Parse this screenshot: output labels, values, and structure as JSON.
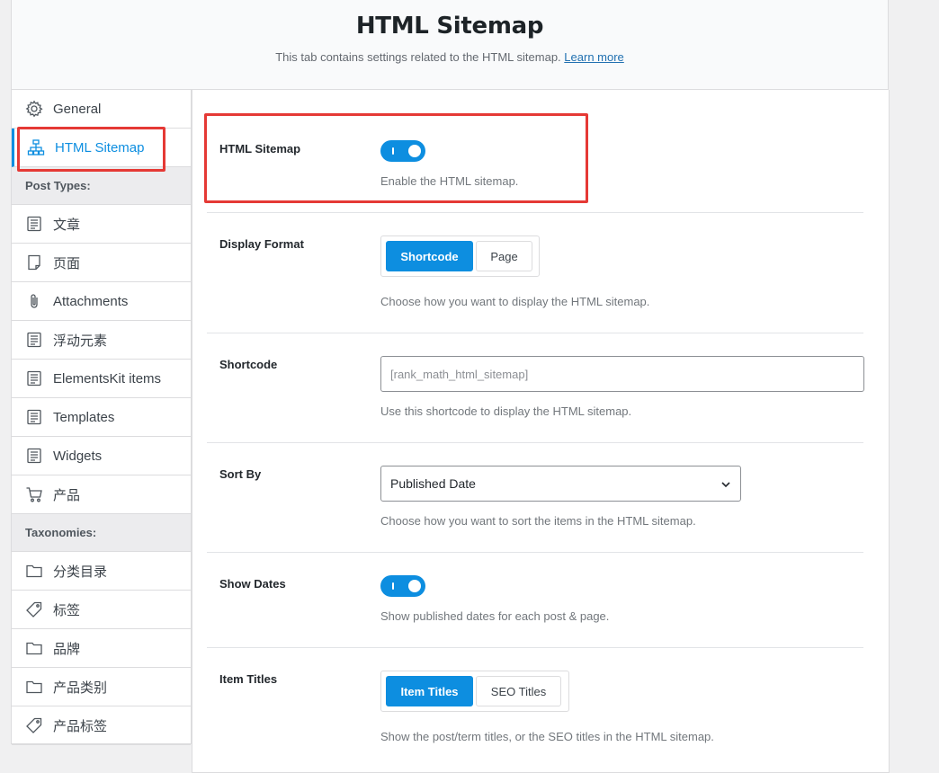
{
  "header": {
    "title": "HTML Sitemap",
    "description": "This tab contains settings related to the HTML sitemap.",
    "learn_more": "Learn more"
  },
  "sidebar": {
    "items": [
      {
        "label": "General",
        "icon": "gear-icon"
      },
      {
        "label": "HTML Sitemap",
        "icon": "sitemap-icon",
        "active": true
      }
    ],
    "post_types_heading": "Post Types:",
    "post_types": [
      {
        "label": "文章",
        "icon": "post-icon"
      },
      {
        "label": "页面",
        "icon": "page-icon"
      },
      {
        "label": "Attachments",
        "icon": "paperclip-icon"
      },
      {
        "label": "浮动元素",
        "icon": "post-icon"
      },
      {
        "label": "ElementsKit items",
        "icon": "post-icon"
      },
      {
        "label": "Templates",
        "icon": "post-icon"
      },
      {
        "label": "Widgets",
        "icon": "post-icon"
      },
      {
        "label": "产品",
        "icon": "cart-icon"
      }
    ],
    "taxonomies_heading": "Taxonomies:",
    "taxonomies": [
      {
        "label": "分类目录",
        "icon": "folder-icon"
      },
      {
        "label": "标签",
        "icon": "tag-icon"
      },
      {
        "label": "品牌",
        "icon": "folder-icon"
      },
      {
        "label": "产品类别",
        "icon": "folder-icon"
      },
      {
        "label": "产品标签",
        "icon": "tag-icon"
      }
    ]
  },
  "settings": {
    "html_sitemap": {
      "label": "HTML Sitemap",
      "enabled": true,
      "desc": "Enable the HTML sitemap."
    },
    "display_format": {
      "label": "Display Format",
      "options": [
        "Shortcode",
        "Page"
      ],
      "selected": "Shortcode",
      "desc": "Choose how you want to display the HTML sitemap."
    },
    "shortcode": {
      "label": "Shortcode",
      "value": "[rank_math_html_sitemap]",
      "desc": "Use this shortcode to display the HTML sitemap."
    },
    "sort_by": {
      "label": "Sort By",
      "value": "Published Date",
      "desc": "Choose how you want to sort the items in the HTML sitemap."
    },
    "show_dates": {
      "label": "Show Dates",
      "enabled": true,
      "desc": "Show published dates for each post & page."
    },
    "item_titles": {
      "label": "Item Titles",
      "options": [
        "Item Titles",
        "SEO Titles"
      ],
      "selected": "Item Titles",
      "desc": "Show the post/term titles, or the SEO titles in the HTML sitemap."
    }
  },
  "colors": {
    "accent": "#0d8ee0",
    "highlight": "#e53935"
  }
}
